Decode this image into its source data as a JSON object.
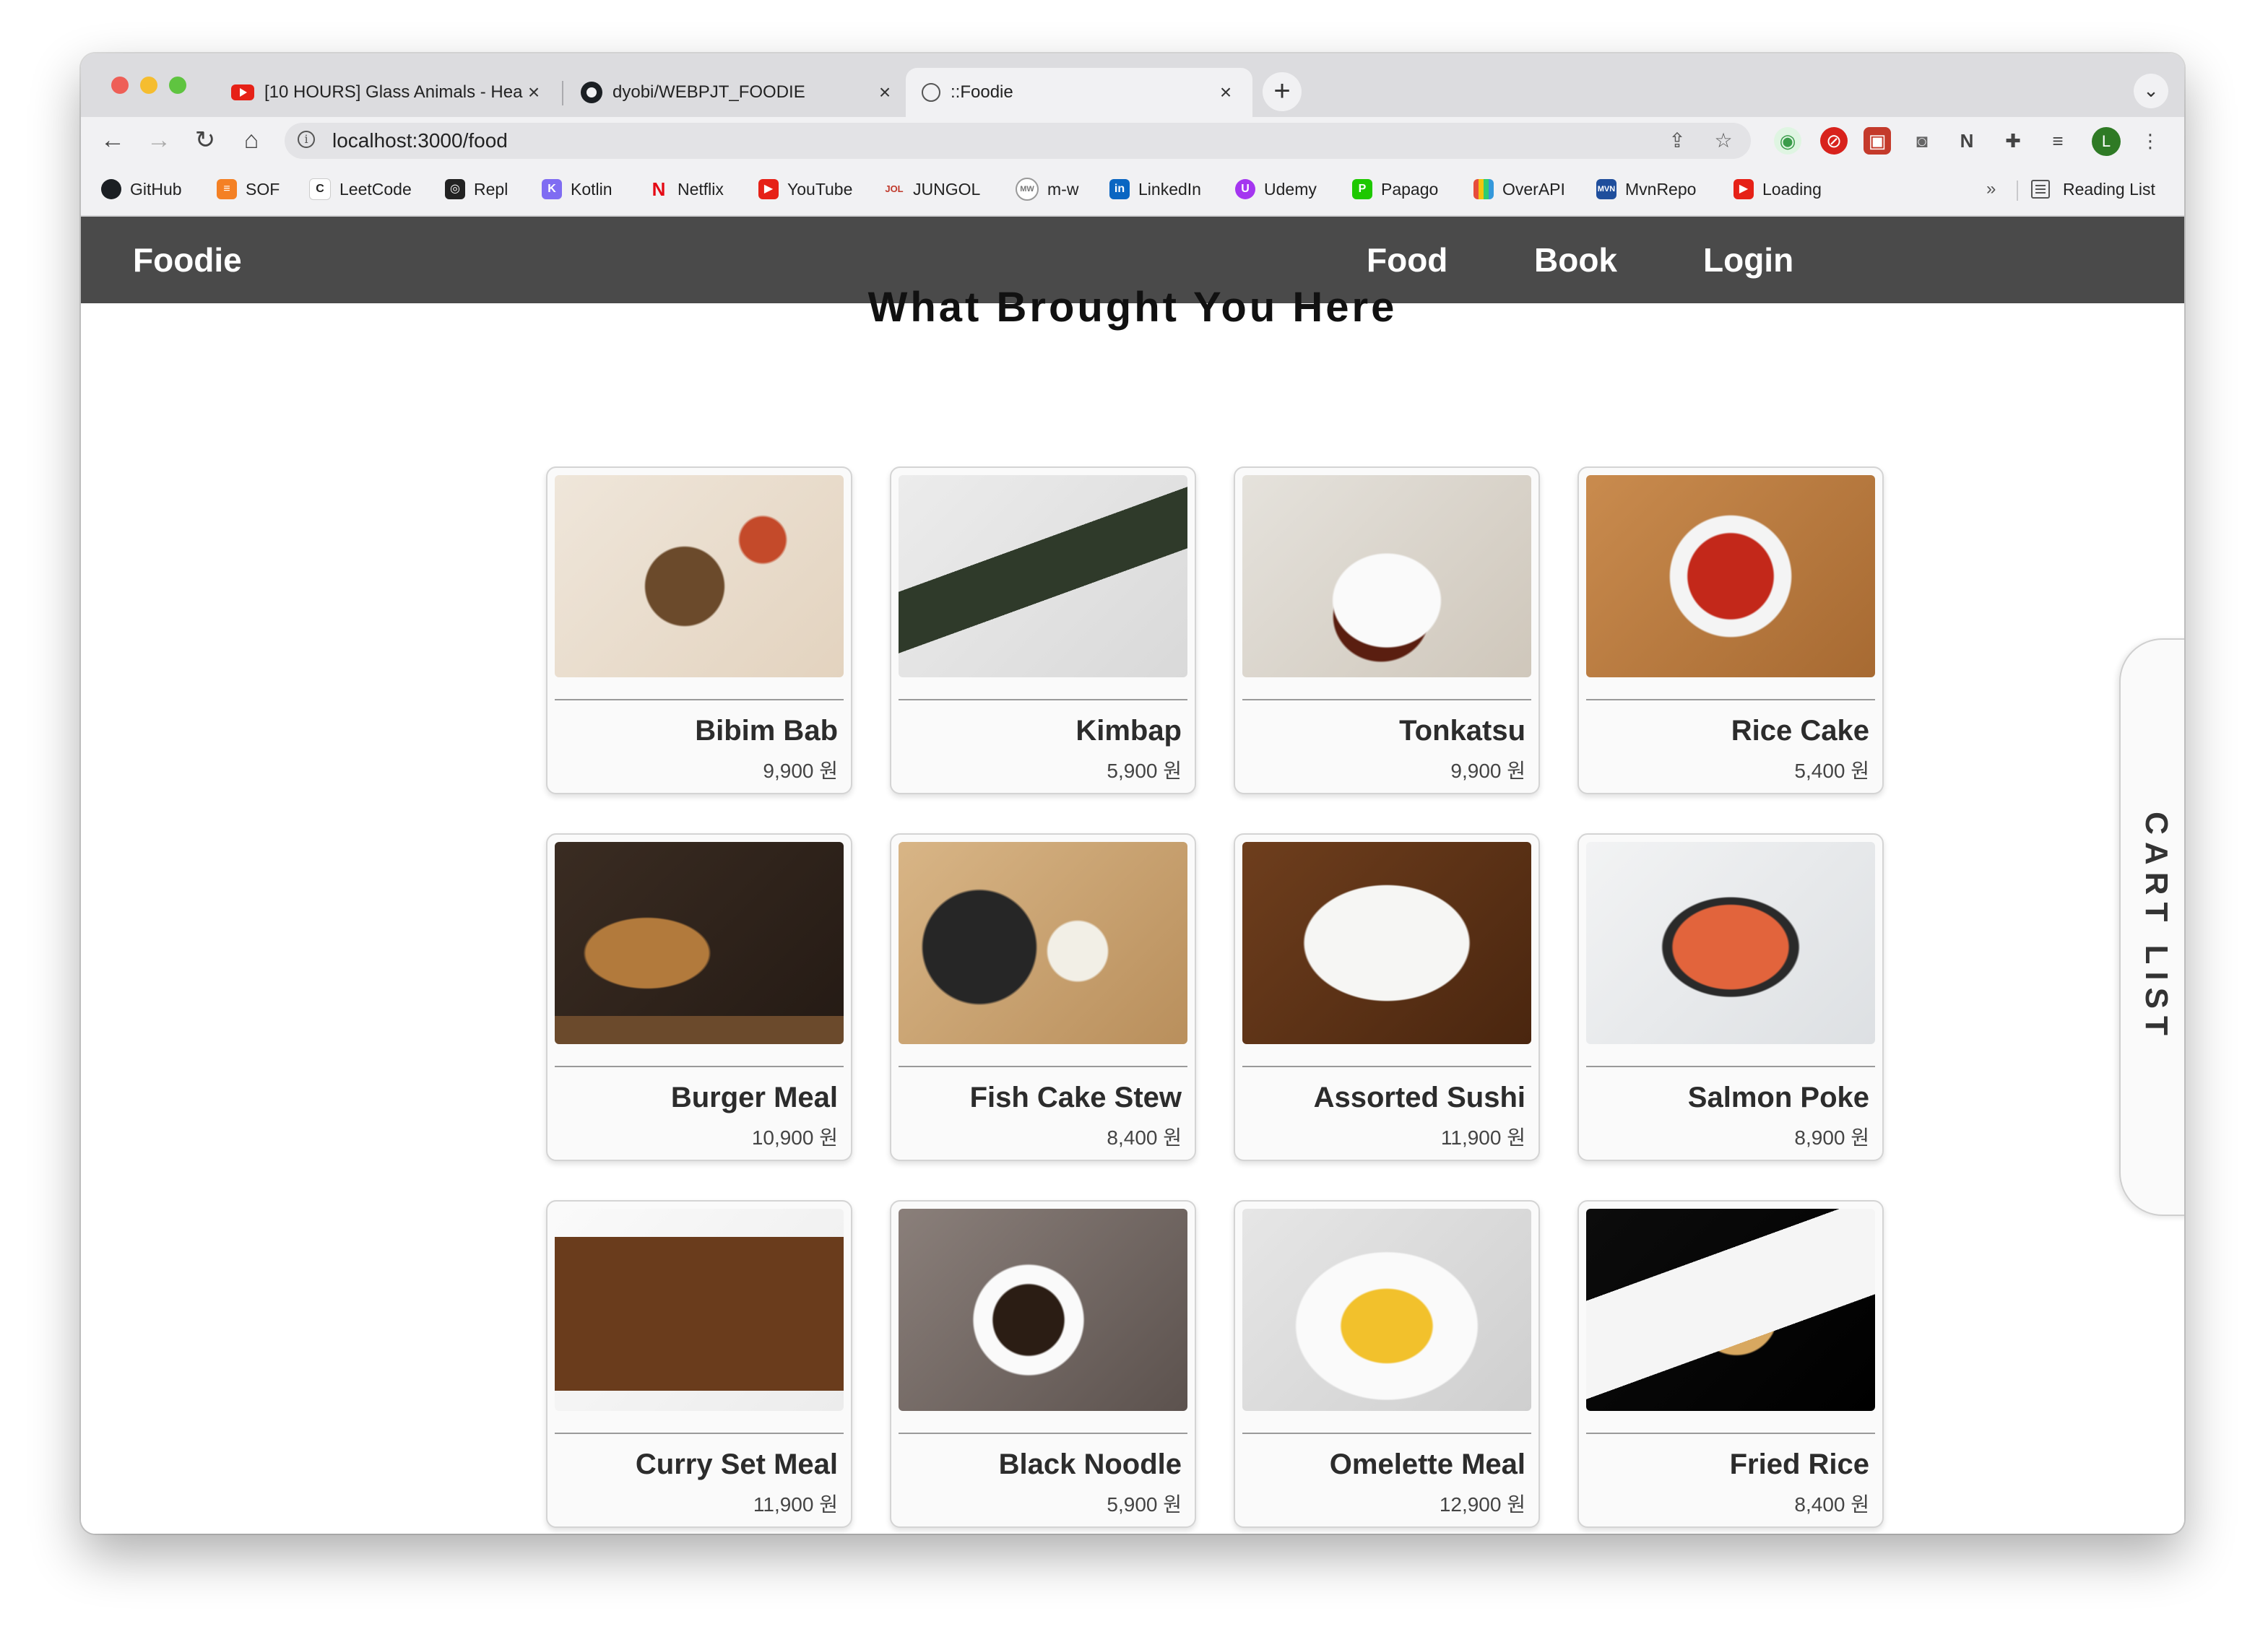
{
  "browser": {
    "tabs": [
      {
        "title": "[10 HOURS] Glass Animals - Hea",
        "favicon": "youtube-icon"
      },
      {
        "title": "dyobi/WEBPJT_FOODIE",
        "favicon": "github-icon"
      },
      {
        "title": "::Foodie",
        "favicon": "globe-icon",
        "active": true
      }
    ],
    "url": "localhost:3000/food",
    "profile_initial": "L",
    "bookmarks": [
      {
        "label": "GitHub",
        "icon": "github-icon"
      },
      {
        "label": "SOF",
        "icon": "stackoverflow-icon"
      },
      {
        "label": "LeetCode",
        "icon": "leetcode-icon"
      },
      {
        "label": "Repl",
        "icon": "repl-icon"
      },
      {
        "label": "Kotlin",
        "icon": "kotlin-icon"
      },
      {
        "label": "Netflix",
        "icon": "netflix-icon"
      },
      {
        "label": "YouTube",
        "icon": "youtube-icon"
      },
      {
        "label": "JUNGOL",
        "icon": "jungol-icon"
      },
      {
        "label": "m-w",
        "icon": "merriam-webster-icon"
      },
      {
        "label": "LinkedIn",
        "icon": "linkedin-icon"
      },
      {
        "label": "Udemy",
        "icon": "udemy-icon"
      },
      {
        "label": "Papago",
        "icon": "papago-icon"
      },
      {
        "label": "OverAPI",
        "icon": "overapi-icon"
      },
      {
        "label": "MvnRepo",
        "icon": "mvnrepo-icon"
      },
      {
        "label": "Loading",
        "icon": "youtube-icon"
      }
    ],
    "bookmarks_overflow": "»",
    "reading_list": "Reading List"
  },
  "site": {
    "brand": "Foodie",
    "nav": [
      "Food",
      "Book",
      "Login"
    ],
    "heading": "What Brought You Here",
    "cart_label": "CART LIST",
    "colors": {
      "navbar": "#4a4a4a",
      "card_bg": "#fafafa"
    }
  },
  "foods": [
    {
      "name": "Bibim Bab",
      "price": "9,900 원"
    },
    {
      "name": "Kimbap",
      "price": "5,900 원"
    },
    {
      "name": "Tonkatsu",
      "price": "9,900 원"
    },
    {
      "name": "Rice Cake",
      "price": "5,400 원"
    },
    {
      "name": "Burger Meal",
      "price": "10,900 원"
    },
    {
      "name": "Fish Cake Stew",
      "price": "8,400 원"
    },
    {
      "name": "Assorted Sushi",
      "price": "11,900 원"
    },
    {
      "name": "Salmon Poke",
      "price": "8,900 원"
    },
    {
      "name": "Curry Set Meal",
      "price": "11,900 원"
    },
    {
      "name": "Black Noodle",
      "price": "5,900 원"
    },
    {
      "name": "Omelette Meal",
      "price": "12,900 원"
    },
    {
      "name": "Fried Rice",
      "price": "8,400 원"
    }
  ]
}
